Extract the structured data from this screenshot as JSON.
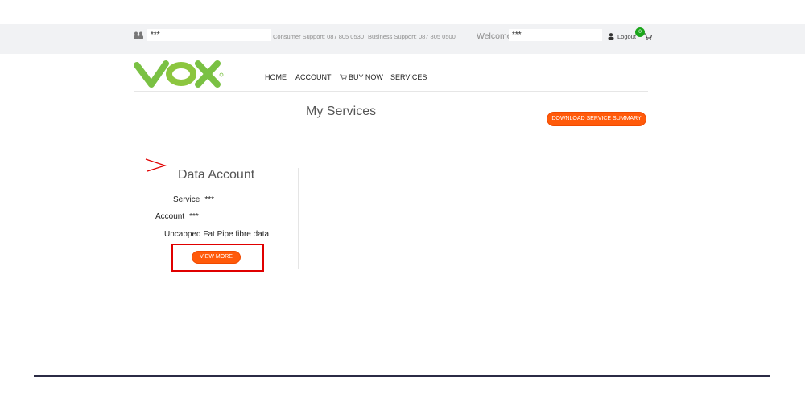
{
  "topbar": {
    "account_value": "***",
    "consumer_support": "Consumer Support: 087 805 0530",
    "business_support": "Business Support: 087 805 0500",
    "welcome_label": "Welcome,",
    "welcome_value": "***",
    "logout_label": "Logout",
    "cart_count": "0"
  },
  "nav": {
    "home": "HOME",
    "account": "ACCOUNT",
    "buy_now": "BUY NOW",
    "services": "SERVICES"
  },
  "page": {
    "title": "My Services",
    "download_button": "DOWNLOAD SERVICE SUMMARY"
  },
  "card": {
    "title": "Data Account",
    "service_label": "Service",
    "service_value": "***",
    "account_label": "Account",
    "account_value": "***",
    "plan": "Uncapped Fat Pipe fibre data",
    "view_more": "VIEW MORE"
  },
  "colors": {
    "accent_orange": "#ff5a0a",
    "logo_green": "#7ac143",
    "badge_green": "#1aa51a",
    "annotation_red": "#e00000"
  },
  "icons": [
    "users-icon",
    "person-icon",
    "cart-icon",
    "arrow-annotation-icon"
  ]
}
